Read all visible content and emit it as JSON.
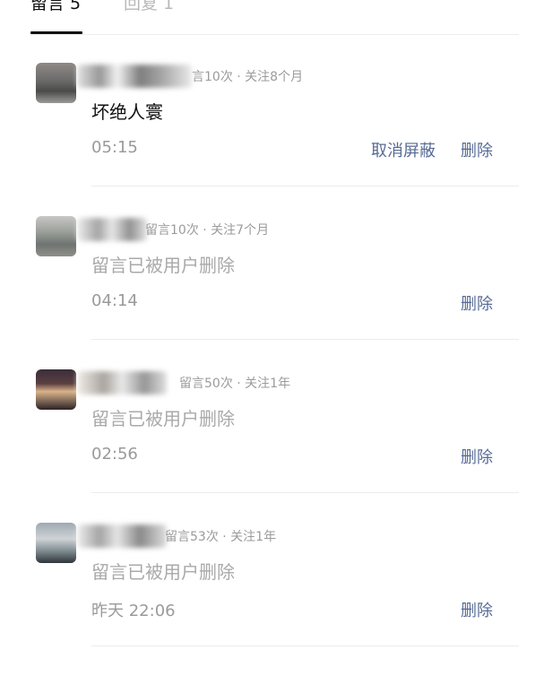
{
  "tabs": [
    {
      "label": "留言 5"
    },
    {
      "label": "回复 1"
    }
  ],
  "comments": [
    {
      "meta": "言10次 · 关注8个月",
      "text": "坏绝人寰",
      "time": "05:15",
      "unhide_label": "取消屏蔽",
      "delete_label": "删除"
    },
    {
      "meta": "留言10次 · 关注7个月",
      "text": "留言已被用户删除",
      "time": "04:14",
      "delete_label": "删除"
    },
    {
      "meta": "留言50次 · 关注1年",
      "text": "留言已被用户删除",
      "time": "02:56",
      "delete_label": "删除"
    },
    {
      "meta": "留言53次 · 关注1年",
      "text": "留言已被用户删除",
      "time": "昨天 22:06",
      "delete_label": "删除"
    }
  ]
}
